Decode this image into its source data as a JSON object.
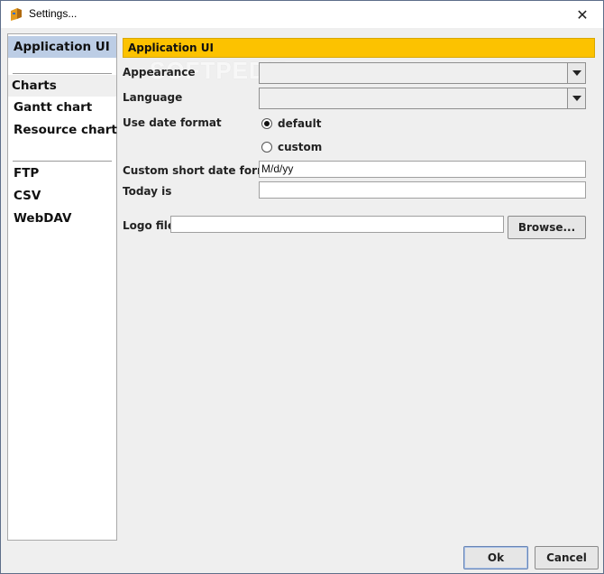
{
  "window": {
    "title": "Settings...",
    "close_glyph": "✕"
  },
  "nav": {
    "items": [
      {
        "label": "Application UI",
        "selected": true
      },
      {
        "label": "Charts",
        "group": true
      },
      {
        "label": "Gantt chart"
      },
      {
        "label": "Resource chart"
      },
      {
        "label": "FTP"
      },
      {
        "label": "CSV"
      },
      {
        "label": "WebDAV"
      }
    ]
  },
  "panel": {
    "header": "Application UI",
    "watermark": "SOFTPEDIA",
    "appearance": {
      "label": "Appearance",
      "value": ""
    },
    "language": {
      "label": "Language",
      "value": ""
    },
    "date_format": {
      "label": "Use date format",
      "options": [
        {
          "label": "default",
          "checked": true
        },
        {
          "label": "custom",
          "checked": false
        }
      ]
    },
    "custom_short_date": {
      "label": "Custom short date format",
      "value": "M/d/yy"
    },
    "today_is": {
      "label": "Today is",
      "value": ""
    },
    "logo_file": {
      "label": "Logo file",
      "value": "",
      "browse_label": "Browse..."
    }
  },
  "footer": {
    "ok_label": "Ok",
    "cancel_label": "Cancel"
  },
  "colors": {
    "header_bg": "#fcc200",
    "nav_selected_bg": "#bccde5"
  },
  "icons": {
    "app": "ganttproject-app-icon",
    "close": "close-icon",
    "combo_arrow": "chevron-down-icon"
  }
}
